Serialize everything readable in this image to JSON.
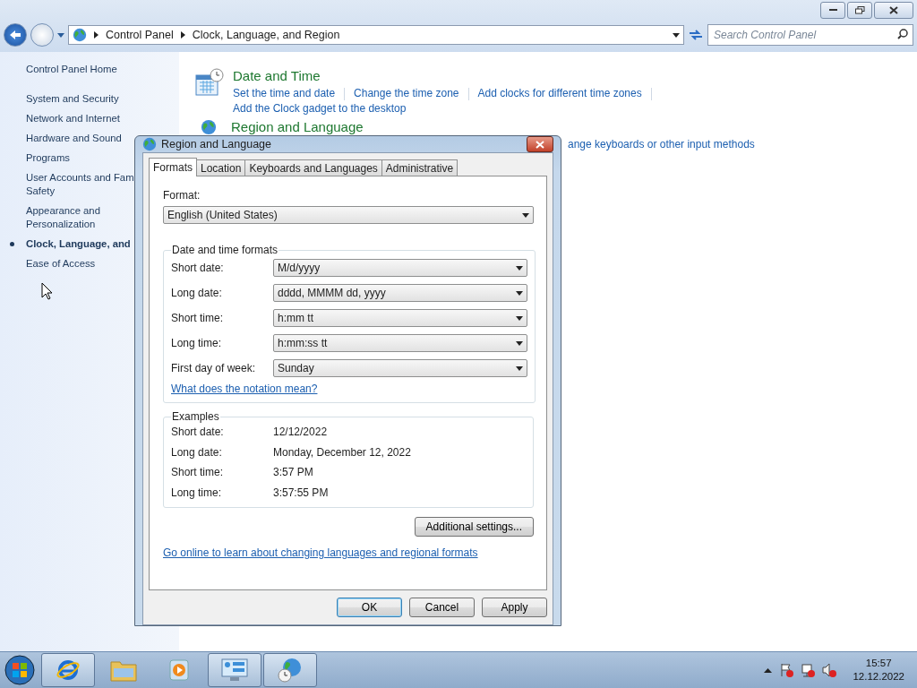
{
  "window": {
    "breadcrumb": [
      "Control Panel",
      "Clock, Language, and Region"
    ],
    "search": {
      "placeholder": "Search Control Panel"
    }
  },
  "sidebar": {
    "home": "Control Panel Home",
    "items": [
      {
        "label": "System and Security",
        "selected": false
      },
      {
        "label": "Network and Internet",
        "selected": false
      },
      {
        "label": "Hardware and Sound",
        "selected": false
      },
      {
        "label": "Programs",
        "selected": false
      },
      {
        "label": "User Accounts and Fam\nSafety",
        "selected": false
      },
      {
        "label": "Appearance and\nPersonalization",
        "selected": false
      },
      {
        "label": "Clock, Language, and",
        "selected": true
      },
      {
        "label": "Ease of Access",
        "selected": false
      }
    ]
  },
  "sections": [
    {
      "kind": "calendar",
      "title": "Date and Time",
      "links": [
        "Set the time and date",
        "Change the time zone",
        "Add clocks for different time zones"
      ],
      "extra_link": "Add the Clock gadget to the desktop"
    },
    {
      "kind": "globe",
      "title": "Region and Language",
      "links": [
        "ange keyboards or other input methods"
      ]
    }
  ],
  "dialog": {
    "title": "Region and Language",
    "tabs": [
      {
        "label": "Formats",
        "selected": true
      },
      {
        "label": "Location",
        "selected": false
      },
      {
        "label": "Keyboards and Languages",
        "selected": false
      },
      {
        "label": "Administrative",
        "selected": false
      }
    ],
    "format_label": "Format:",
    "format_value": "English (United States)",
    "group_title": "Date and time formats",
    "fields": [
      {
        "label": "Short date:",
        "value": "M/d/yyyy"
      },
      {
        "label": "Long date:",
        "value": "dddd, MMMM dd, yyyy"
      },
      {
        "label": "Short time:",
        "value": "h:mm tt"
      },
      {
        "label": "Long time:",
        "value": "h:mm:ss tt"
      },
      {
        "label": "First day of week:",
        "value": "Sunday"
      }
    ],
    "notation_link": "What does the notation mean?",
    "examples_title": "Examples",
    "examples": [
      {
        "label": "Short date:",
        "value": "12/12/2022"
      },
      {
        "label": "Long date:",
        "value": "Monday, December 12, 2022"
      },
      {
        "label": "Short time:",
        "value": "3:57 PM"
      },
      {
        "label": "Long time:",
        "value": "3:57:55 PM"
      }
    ],
    "additional_button": "Additional settings...",
    "online_link": "Go online to learn about changing languages and regional formats",
    "buttons": [
      {
        "label": "OK",
        "default": true
      },
      {
        "label": "Cancel",
        "default": false
      },
      {
        "label": "Apply",
        "default": false
      }
    ]
  },
  "taskbar": {
    "apps": [
      {
        "kind": "browser",
        "running": true
      },
      {
        "kind": "folder",
        "running": false
      },
      {
        "kind": "media",
        "running": false
      },
      {
        "kind": "panel",
        "running": true
      },
      {
        "kind": "globe",
        "running": true
      }
    ],
    "time": "15:57",
    "date": "12.12.2022"
  }
}
